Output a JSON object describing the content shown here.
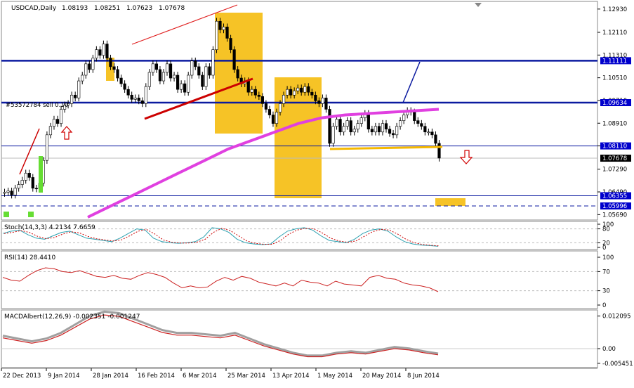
{
  "chart_data": [
    {
      "type": "candlestick",
      "title": "USDCAD,Daily",
      "ohlc_header": {
        "open": "1.08193",
        "high": "1.08251",
        "low": "1.07623",
        "close": "1.07678"
      },
      "y_ticks": [
        "1.12930",
        "1.12110",
        "1.11310",
        "1.10510",
        "1.09710",
        "1.08910",
        "1.08110",
        "1.07290",
        "1.06490",
        "1.05690"
      ],
      "level_labels": [
        {
          "value": "1.11111",
          "color": "#0000cc"
        },
        {
          "value": "1.09634",
          "color": "#0000cc"
        },
        {
          "value": "1.08110",
          "color": "#0000cc"
        },
        {
          "value": "1.07678",
          "color": "#ffffff"
        },
        {
          "value": "1.06355",
          "color": "#0000cc"
        },
        {
          "value": "1.05996",
          "color": "#0000cc"
        }
      ],
      "order_label": "#53572784 sell 0.10",
      "x_ticks": [
        "22 Dec 2013",
        "9 Jan 2014",
        "28 Jan 2014",
        "16 Feb 2014",
        "6 Mar 2014",
        "25 Mar 2014",
        "13 Apr 2014",
        "1 May 2014",
        "20 May 2014",
        "8 Jun 2014"
      ],
      "ylim": [
        1.0555,
        1.131
      ],
      "series": [
        {
          "name": "price_close",
          "values": [
            1.0648,
            1.0652,
            1.0638,
            1.0662,
            1.0675,
            1.069,
            1.0715,
            1.07,
            1.0662,
            1.066,
            1.068,
            1.076,
            1.085,
            1.088,
            1.0905,
            1.089,
            1.094,
            1.0955,
            1.096,
            1.099,
            1.098,
            1.104,
            1.106,
            1.11,
            1.108,
            1.112,
            1.115,
            1.113,
            1.117,
            1.112,
            1.109,
            1.108,
            1.105,
            1.103,
            1.101,
            1.099,
            1.0975,
            1.098,
            1.097,
            1.096,
            1.102,
            1.107,
            1.11,
            1.108,
            1.104,
            1.107,
            1.11,
            1.105,
            1.106,
            1.101,
            1.103,
            1.1,
            1.106,
            1.111,
            1.109,
            1.106,
            1.102,
            1.109,
            1.106,
            1.115,
            1.125,
            1.122,
            1.123,
            1.119,
            1.115,
            1.108,
            1.105,
            1.103,
            1.104,
            1.1,
            1.101,
            1.099,
            1.0985,
            1.096,
            1.094,
            1.092,
            1.089,
            1.093,
            1.096,
            1.099,
            1.101,
            1.099,
            1.1005,
            1.1015,
            1.1,
            1.102,
            1.1,
            1.099,
            1.097,
            1.096,
            1.098,
            1.094,
            1.082,
            1.088,
            1.0905,
            1.086,
            1.088,
            1.09,
            1.086,
            1.087,
            1.089,
            1.091,
            1.0925,
            1.087,
            1.086,
            1.088,
            1.086,
            1.089,
            1.087,
            1.0855,
            1.085,
            1.088,
            1.09,
            1.092,
            1.0935,
            1.093,
            1.09,
            1.089,
            1.088,
            1.086,
            1.086,
            1.085,
            1.082,
            1.0768
          ]
        },
        {
          "name": "ma_magenta",
          "values": [
            1.056,
            1.06,
            1.064,
            1.068,
            1.072,
            1.076,
            1.08,
            1.083,
            1.086,
            1.089,
            1.091,
            1.092,
            1.0925,
            1.093,
            1.0935,
            1.094
          ]
        },
        {
          "name": "Stoch(14,3,3) 4.2134 7.6659",
          "values": [
            60,
            70,
            75,
            55,
            40,
            35,
            50,
            65,
            70,
            55,
            40,
            35,
            30,
            25,
            40,
            60,
            80,
            75,
            40,
            25,
            20,
            18,
            20,
            25,
            45,
            85,
            80,
            65,
            35,
            20,
            15,
            12,
            15,
            45,
            70,
            80,
            85,
            75,
            50,
            30,
            25,
            20,
            35,
            60,
            75,
            80,
            70,
            45,
            25,
            15,
            10,
            8,
            5
          ]
        },
        {
          "name": "RSI(14) 28.4410",
          "values": [
            58,
            52,
            50,
            62,
            72,
            78,
            76,
            70,
            68,
            72,
            66,
            60,
            58,
            62,
            56,
            54,
            62,
            68,
            64,
            58,
            46,
            36,
            40,
            36,
            38,
            50,
            58,
            52,
            60,
            56,
            48,
            44,
            40,
            46,
            40,
            52,
            48,
            46,
            40,
            50,
            44,
            42,
            40,
            58,
            62,
            56,
            54,
            46,
            42,
            40,
            36,
            28
          ]
        },
        {
          "name": "MACDAlbert(12,26,9) -0.002351 -0.001247",
          "values": [
            0.004,
            0.003,
            0.002,
            0.003,
            0.005,
            0.008,
            0.011,
            0.0125,
            0.012,
            0.01,
            0.008,
            0.006,
            0.005,
            0.005,
            0.0045,
            0.004,
            0.005,
            0.003,
            0.001,
            -0.0005,
            -0.002,
            -0.003,
            -0.003,
            -0.002,
            -0.0015,
            -0.002,
            -0.001,
            0.0,
            -0.0005,
            -0.0015,
            -0.0023
          ]
        }
      ],
      "sub_ticks": {
        "stoch": [
          "100",
          "80",
          "20",
          "0"
        ],
        "rsi": [
          "100",
          "70",
          "30",
          "0"
        ],
        "macd": [
          "0.012095",
          "0.00",
          "-0.005451"
        ]
      },
      "colors": {
        "up": "#00cc00",
        "down": "#ff0000",
        "box": "#f5b800",
        "level": "#0000a0",
        "ma": "#e040e0",
        "trend": "#cc0000"
      }
    }
  ]
}
